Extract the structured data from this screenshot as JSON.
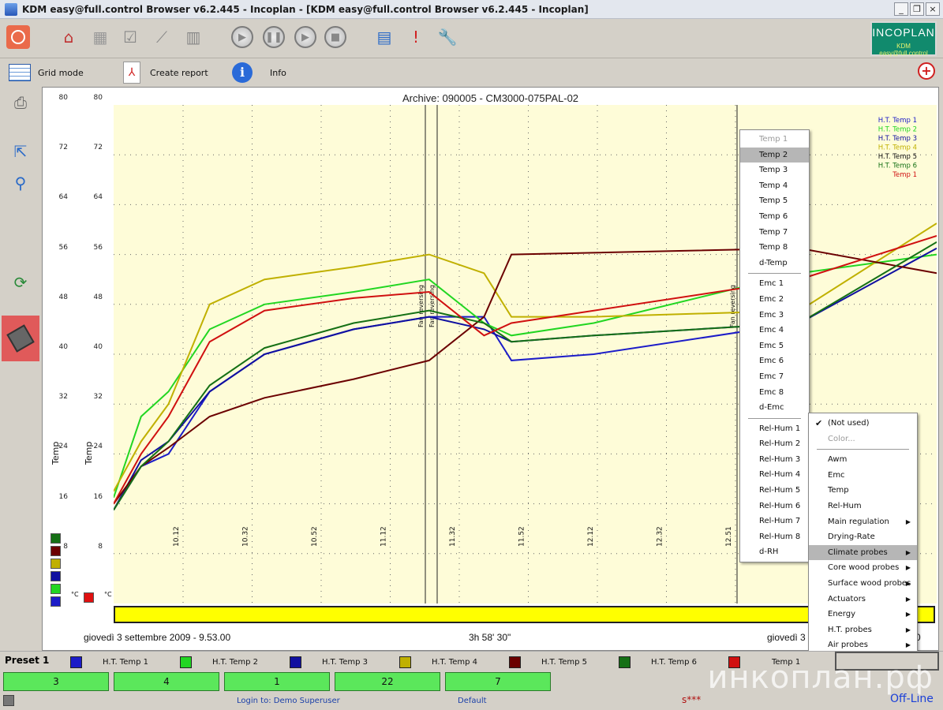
{
  "window": {
    "title": "KDM easy@full.control Browser v6.2.445 - Incoplan - [KDM easy@full.control Browser v6.2.445 - Incoplan]",
    "buttons": [
      "_",
      "❐",
      "×"
    ]
  },
  "logo": {
    "line1": "INCOPLAN",
    "line2": "KDM easy@full.control"
  },
  "sub_toolbar": {
    "grid_mode": "Grid mode",
    "create_report": "Create report",
    "info": "Info"
  },
  "plot": {
    "title": "Archive: 090005  -  CM3000-075PAL-02",
    "axis1_label": "Temp",
    "axis2_label": "Temp",
    "unit": "°C",
    "ticks": [
      "80",
      "72",
      "64",
      "56",
      "48",
      "40",
      "32",
      "24",
      "16",
      "8"
    ],
    "start_date": "giovedì 3 settembre 2009  -  9.53.00",
    "duration": "3h 58' 30\"",
    "end_date": "giovedì 3 s",
    "end_suffix": "0",
    "annotations": [
      "Fan reversing",
      "Fan reversing",
      "Fan reversing"
    ],
    "legend_lines": [
      {
        "label": "H.T. Temp 1",
        "color": "#1c1cc8"
      },
      {
        "label": "H.T. Temp 2",
        "color": "#22d622"
      },
      {
        "label": "H.T. Temp 3",
        "color": "#1010a0"
      },
      {
        "label": "H.T. Temp 4",
        "color": "#c0b000"
      },
      {
        "label": "H.T. Temp 5",
        "color": "#111111"
      },
      {
        "label": "H.T. Temp 6",
        "color": "#157015"
      },
      {
        "label": "Temp 1",
        "color": "#d01010"
      }
    ]
  },
  "chart_data": {
    "type": "line",
    "x": [
      "10.12",
      "10.32",
      "10.52",
      "11.12",
      "11.32",
      "11.52",
      "12.12",
      "12.32",
      "12.51"
    ],
    "ylim": [
      0,
      80
    ],
    "ylabel": "Temp",
    "grid": true,
    "legend": "top-right",
    "series": [
      {
        "name": "H.T. Temp 1",
        "color": "#1c1cc8",
        "points": [
          [
            0,
            15
          ],
          [
            4,
            22
          ],
          [
            8,
            24
          ],
          [
            14,
            34
          ],
          [
            22,
            40
          ],
          [
            35,
            44
          ],
          [
            46,
            46
          ],
          [
            54,
            46
          ],
          [
            58,
            39
          ],
          [
            70,
            40
          ],
          [
            100,
            45
          ]
        ]
      },
      {
        "name": "H.T. Temp 2",
        "color": "#22d622",
        "points": [
          [
            0,
            17
          ],
          [
            4,
            30
          ],
          [
            8,
            34
          ],
          [
            14,
            44
          ],
          [
            22,
            48
          ],
          [
            35,
            50
          ],
          [
            46,
            52
          ],
          [
            54,
            45
          ],
          [
            58,
            43
          ],
          [
            70,
            45
          ],
          [
            100,
            53
          ],
          [
            120,
            56
          ]
        ]
      },
      {
        "name": "H.T. Temp 3",
        "color": "#1010a0",
        "points": [
          [
            0,
            15
          ],
          [
            4,
            23
          ],
          [
            8,
            26
          ],
          [
            14,
            34
          ],
          [
            22,
            40
          ],
          [
            35,
            44
          ],
          [
            46,
            46
          ],
          [
            54,
            44
          ],
          [
            58,
            42
          ],
          [
            70,
            43
          ],
          [
            100,
            45
          ],
          [
            120,
            57
          ]
        ]
      },
      {
        "name": "H.T. Temp 4",
        "color": "#c0b000",
        "points": [
          [
            0,
            18
          ],
          [
            4,
            26
          ],
          [
            8,
            32
          ],
          [
            14,
            48
          ],
          [
            22,
            52
          ],
          [
            35,
            54
          ],
          [
            46,
            56
          ],
          [
            54,
            53
          ],
          [
            58,
            46
          ],
          [
            70,
            46
          ],
          [
            100,
            47
          ],
          [
            120,
            61
          ]
        ]
      },
      {
        "name": "H.T. Temp 5",
        "color": "#6b0000",
        "points": [
          [
            0,
            16
          ],
          [
            4,
            22
          ],
          [
            8,
            25
          ],
          [
            14,
            30
          ],
          [
            22,
            33
          ],
          [
            35,
            36
          ],
          [
            46,
            39
          ],
          [
            54,
            46
          ],
          [
            58,
            56
          ],
          [
            100,
            57
          ],
          [
            120,
            53
          ]
        ]
      },
      {
        "name": "H.T. Temp 6",
        "color": "#157015",
        "points": [
          [
            0,
            15
          ],
          [
            4,
            22
          ],
          [
            8,
            26
          ],
          [
            14,
            35
          ],
          [
            22,
            41
          ],
          [
            35,
            45
          ],
          [
            46,
            47
          ],
          [
            54,
            45
          ],
          [
            58,
            42
          ],
          [
            70,
            43
          ],
          [
            100,
            45
          ],
          [
            120,
            58
          ]
        ]
      },
      {
        "name": "Temp 1",
        "color": "#d01010",
        "points": [
          [
            0,
            16
          ],
          [
            4,
            24
          ],
          [
            8,
            30
          ],
          [
            14,
            42
          ],
          [
            22,
            47
          ],
          [
            35,
            49
          ],
          [
            46,
            50
          ],
          [
            54,
            43
          ],
          [
            58,
            45
          ],
          [
            70,
            47
          ],
          [
            100,
            52
          ],
          [
            120,
            59
          ]
        ]
      }
    ]
  },
  "series_swatches": [
    "#157015",
    "#6b0000",
    "#c0b000",
    "#1010a0",
    "#22d622",
    "#1c1cc8"
  ],
  "preset_label": "Preset 1",
  "legend_items": [
    {
      "label": "H.T. Temp 1",
      "color": "#1c1cc8"
    },
    {
      "label": "H.T. Temp 2",
      "color": "#22d622"
    },
    {
      "label": "H.T. Temp 3",
      "color": "#1010a0"
    },
    {
      "label": "H.T. Temp 4",
      "color": "#c0b000"
    },
    {
      "label": "H.T. Temp 5",
      "color": "#6b0000"
    },
    {
      "label": "H.T. Temp 6",
      "color": "#157015"
    },
    {
      "label": "Temp 1",
      "color": "#d01010"
    }
  ],
  "green_buttons": [
    "3",
    "4",
    "1",
    "22",
    "7"
  ],
  "status": {
    "login": "Login to: Demo Superuser",
    "profile": "Default",
    "code": "s***",
    "mode": "Off-Line"
  },
  "context_menu": {
    "items": [
      "(Not used)",
      "Color...",
      "Awm",
      "Emc",
      "Temp",
      "Rel-Hum",
      "Main regulation",
      "Drying-Rate",
      "Climate probes",
      "Core wood probes",
      "Surface wood probes",
      "Actuators",
      "Energy",
      "H.T. probes",
      "Air probes"
    ]
  },
  "probe_menu": {
    "group1": [
      "Temp 1",
      "Temp 2",
      "Temp 3",
      "Temp 4",
      "Temp 5",
      "Temp 6",
      "Temp 7",
      "Temp 8",
      "d-Temp"
    ],
    "group2": [
      "Emc 1",
      "Emc 2",
      "Emc 3",
      "Emc 4",
      "Emc 5",
      "Emc 6",
      "Emc 7",
      "Emc 8",
      "d-Emc"
    ],
    "group3": [
      "Rel-Hum 1",
      "Rel-Hum 2",
      "Rel-Hum 3",
      "Rel-Hum 4",
      "Rel-Hum 5",
      "Rel-Hum 6",
      "Rel-Hum 7",
      "Rel-Hum 8",
      "d-RH"
    ]
  },
  "watermark": "инкоплан.рф"
}
